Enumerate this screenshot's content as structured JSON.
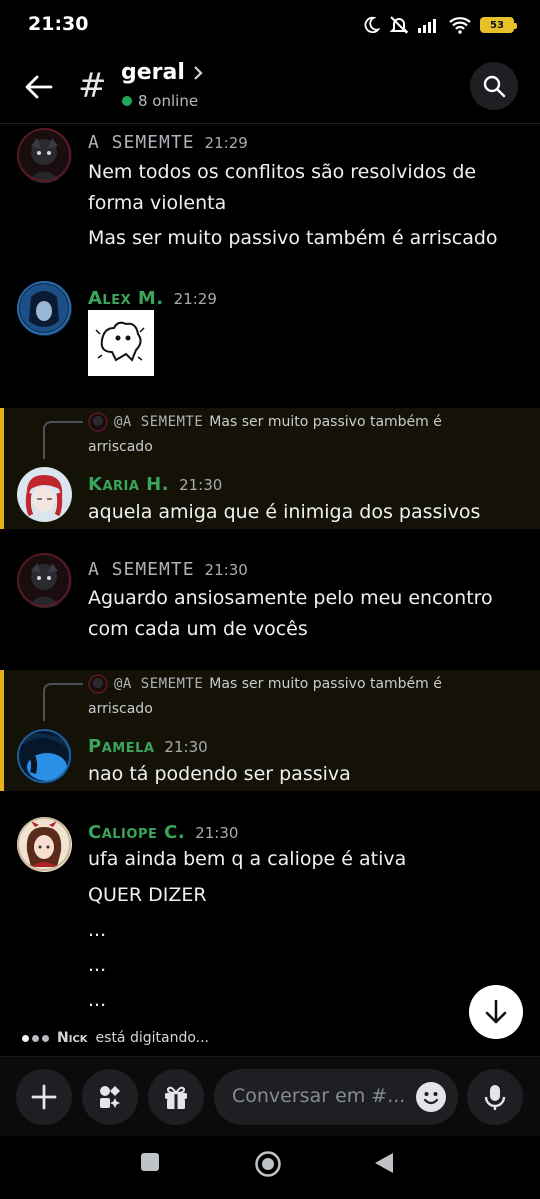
{
  "status_bar": {
    "time": "21:30",
    "battery": "53"
  },
  "header": {
    "channel_name": "geral",
    "online_text": "8 online"
  },
  "messages": [
    {
      "author": "A SEMEMTE",
      "time": "21:29",
      "lines": [
        "Nem todos os conflitos são resolvidos de",
        "forma violenta",
        "Mas ser muito passivo também é arriscado"
      ]
    },
    {
      "author": "Alex M.",
      "time": "21:29"
    },
    {
      "reply_to": "@A SEMEMTE",
      "reply_text_1": "Mas ser muito passivo também é",
      "reply_text_2": "arriscado",
      "author": "Karia H.",
      "time": "21:30",
      "lines": [
        "aquela amiga que é inimiga dos passivos"
      ]
    },
    {
      "author": "A SEMEMTE",
      "time": "21:30",
      "lines": [
        "Aguardo ansiosamente pelo meu encontro",
        "com cada um de vocês"
      ]
    },
    {
      "reply_to": "@A SEMEMTE",
      "reply_text_1": "Mas ser muito passivo também é",
      "reply_text_2": "arriscado",
      "author": "Pamela",
      "time": "21:30",
      "lines": [
        "nao tá podendo ser passiva"
      ]
    },
    {
      "author": "Caliope C.",
      "time": "21:30",
      "lines": [
        "ufa ainda bem q a caliope é ativa",
        "QUER DIZER",
        "...",
        "...",
        "..."
      ]
    }
  ],
  "typing": {
    "name": "Nick",
    "text": "está digitando..."
  },
  "composer": {
    "placeholder": "Conversar em #..."
  },
  "colors": {
    "accent_green": "#3ba55c",
    "reply_highlight": "#e7b11d",
    "online": "#23a55a"
  }
}
